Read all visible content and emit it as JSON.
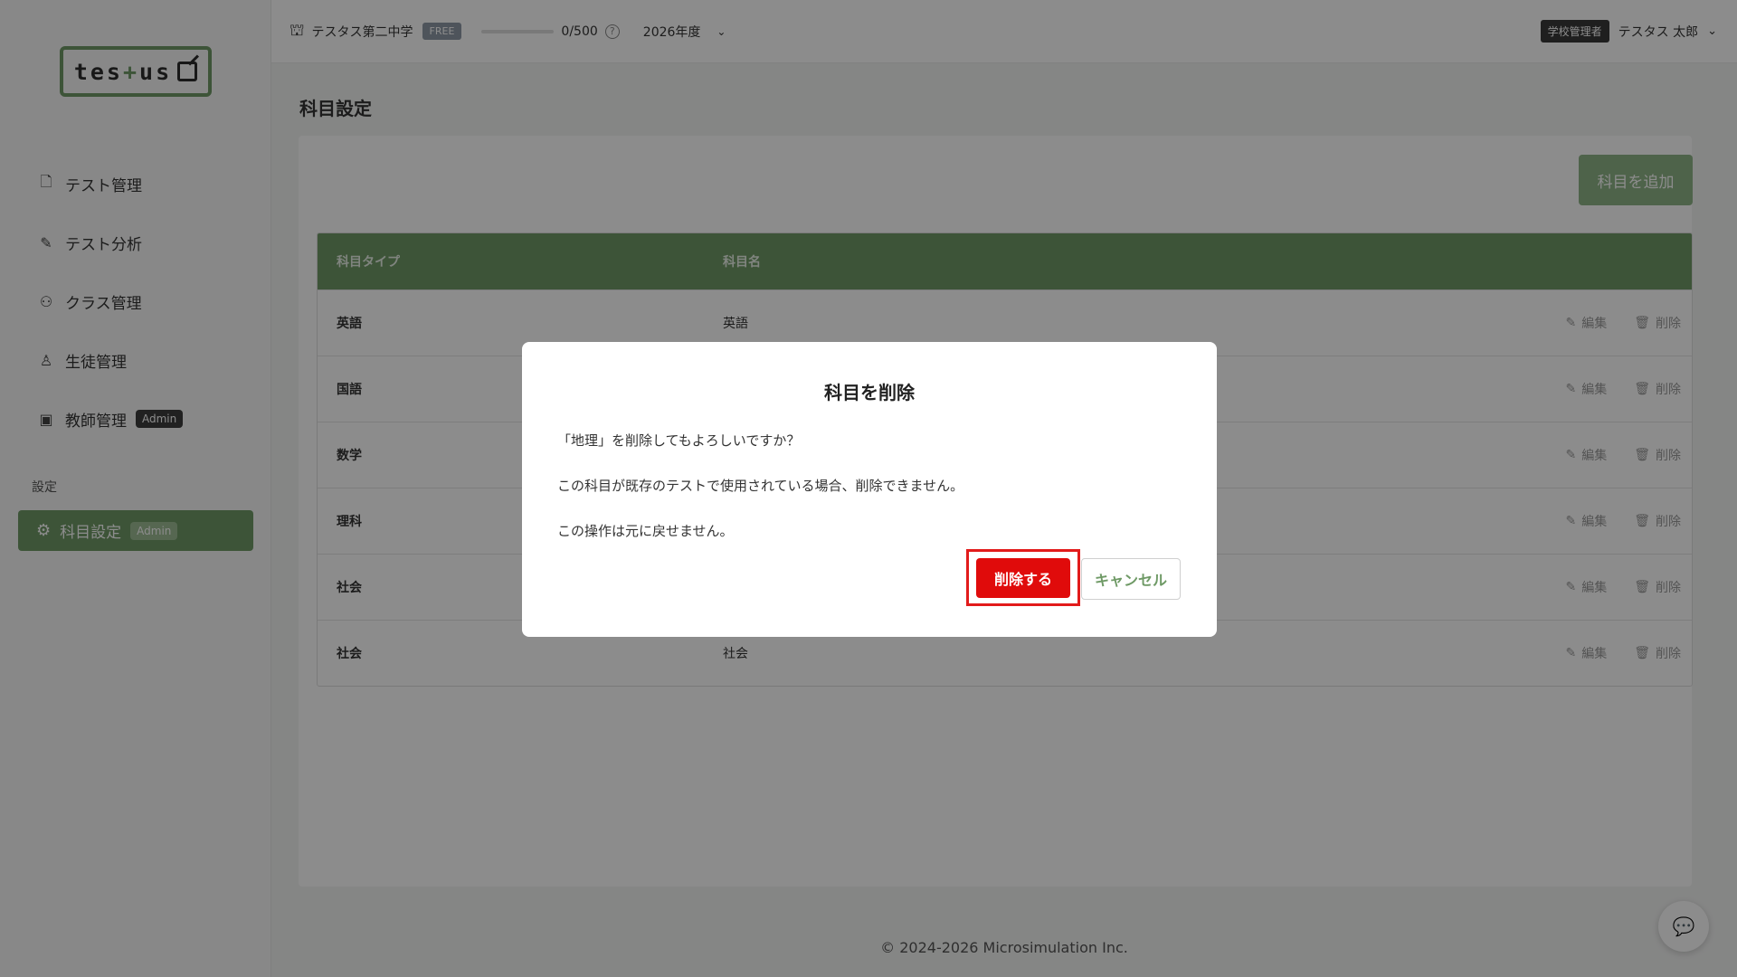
{
  "app": {
    "logo_text": "tes+us",
    "footer": "© 2024-2026 Microsimulation Inc."
  },
  "sidebar": {
    "items": [
      {
        "label": "テスト管理",
        "icon": "document-icon"
      },
      {
        "label": "テスト分析",
        "icon": "analysis-icon"
      },
      {
        "label": "クラス管理",
        "icon": "class-icon"
      },
      {
        "label": "生徒管理",
        "icon": "student-icon"
      },
      {
        "label": "教師管理",
        "icon": "teacher-icon",
        "badge": "Admin"
      }
    ],
    "section_label": "設定",
    "active_item": {
      "label": "科目設定",
      "icon": "gear-icon",
      "badge": "Admin"
    }
  },
  "header": {
    "school_name": "テスタス第二中学",
    "plan": "FREE",
    "quota": "0/500",
    "quota_progress": 0,
    "year": "2026年度",
    "role": "学校管理者",
    "user_name": "テスタス 太郎"
  },
  "main": {
    "title": "科目設定",
    "add_button": "科目を追加",
    "table": {
      "headers": [
        "科目タイプ",
        "科目名"
      ],
      "edit_label": "編集",
      "delete_label": "削除",
      "rows": [
        {
          "type": "英語",
          "name": "英語"
        },
        {
          "type": "国語",
          "name": ""
        },
        {
          "type": "数学",
          "name": ""
        },
        {
          "type": "理科",
          "name": ""
        },
        {
          "type": "社会",
          "name": ""
        },
        {
          "type": "社会",
          "name": "社会"
        }
      ]
    }
  },
  "modal": {
    "title": "科目を削除",
    "line1": "「地理」を削除してもよろしいですか？",
    "line2": "この科目が既存のテストで使用されている場合、削除できません。",
    "line3": "この操作は元に戻せません。",
    "confirm": "削除する",
    "cancel": "キャンセル"
  },
  "colors": {
    "brand_green": "#6f9a66",
    "danger_red": "#e00b0b"
  }
}
